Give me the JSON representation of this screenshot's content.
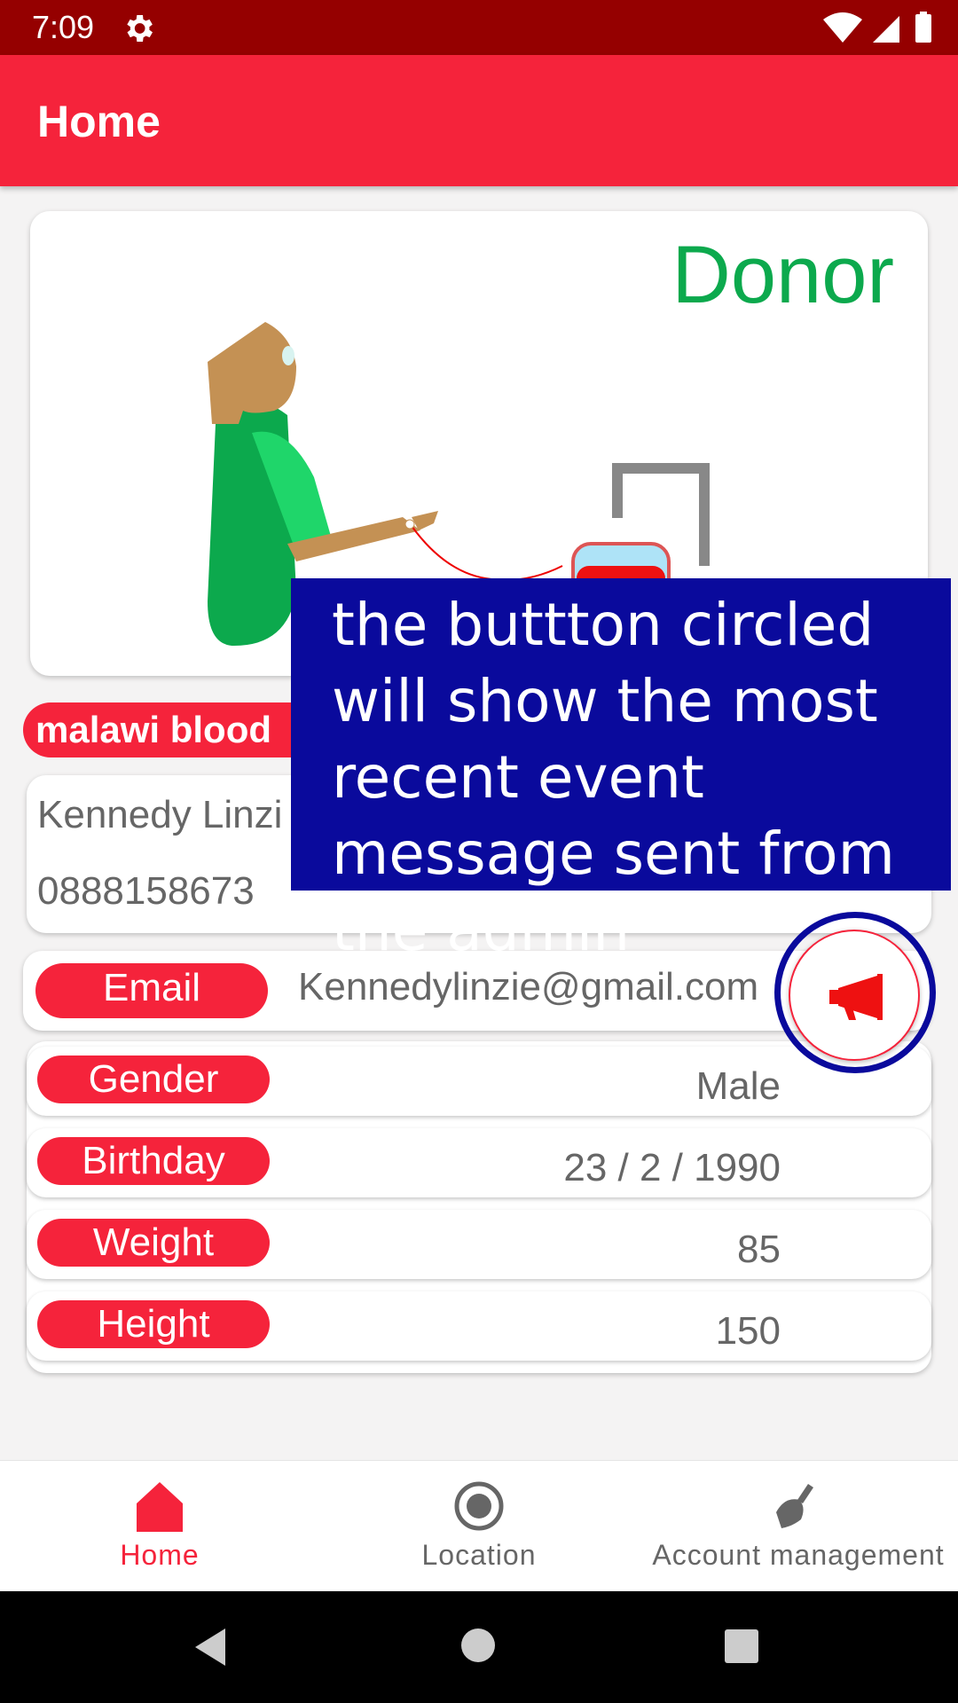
{
  "status_bar": {
    "time": "7:09"
  },
  "app_bar": {
    "title": "Home"
  },
  "hero": {
    "role_label": "Donor"
  },
  "org_badge": "malawi blood",
  "profile": {
    "name": "Kennedy Linzi",
    "phone": "0888158673"
  },
  "email": {
    "label": "Email",
    "value": "Kennedylinzie@gmail.com"
  },
  "details": [
    {
      "label": "Gender",
      "value": "Male"
    },
    {
      "label": "Birthday",
      "value": "23 / 2 / 1990"
    },
    {
      "label": "Weight",
      "value": "85"
    },
    {
      "label": "Height",
      "value": "150"
    }
  ],
  "annotation": "the buttton circled will show the most recent event message sent from the admin",
  "bottom_nav": [
    {
      "label": "Home",
      "icon": "home-icon",
      "active": true
    },
    {
      "label": "Location",
      "icon": "location-icon",
      "active": false
    },
    {
      "label": "Account management",
      "icon": "broom-icon",
      "active": false
    }
  ],
  "colors": {
    "primary": "#f5233b",
    "status_bar": "#950000",
    "donor_green": "#0ca94d",
    "annotation_blue": "#0a0a9c"
  }
}
